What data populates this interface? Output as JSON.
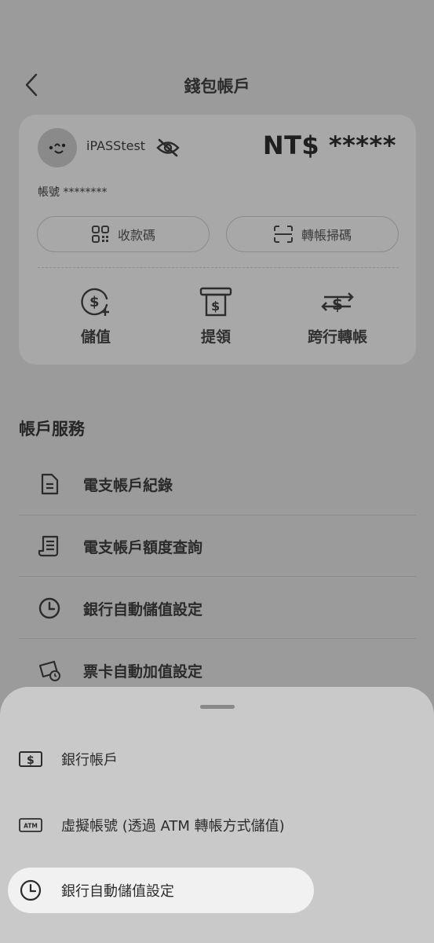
{
  "header": {
    "title": "錢包帳戶"
  },
  "wallet": {
    "username": "iPASStest",
    "balance": "NT$ *****",
    "account": "帳號 ********",
    "receive_label": "收款碼",
    "transfer_scan_label": "轉帳掃碼",
    "actions": [
      {
        "label": "儲值",
        "icon": "dollar-plus-icon"
      },
      {
        "label": "提領",
        "icon": "atm-withdraw-icon"
      },
      {
        "label": "跨行轉帳",
        "icon": "transfer-arrows-icon"
      }
    ]
  },
  "services": {
    "title": "帳戶服務",
    "items": [
      {
        "label": "電支帳戶紀錄",
        "icon": "document-icon"
      },
      {
        "label": "電支帳戶額度查詢",
        "icon": "receipt-icon"
      },
      {
        "label": "銀行自動儲值設定",
        "icon": "clock-icon"
      },
      {
        "label": "票卡自動加值設定",
        "icon": "card-clock-icon"
      }
    ]
  },
  "sheet": {
    "items": [
      {
        "label": "銀行帳戶",
        "icon": "dollar-bill-icon"
      },
      {
        "label": "虛擬帳號 (透過 ATM 轉帳方式儲值)",
        "icon": "atm-icon",
        "icon_text": "ATM"
      },
      {
        "label": "銀行自動儲值設定",
        "icon": "clock-icon",
        "selected": true
      }
    ]
  }
}
